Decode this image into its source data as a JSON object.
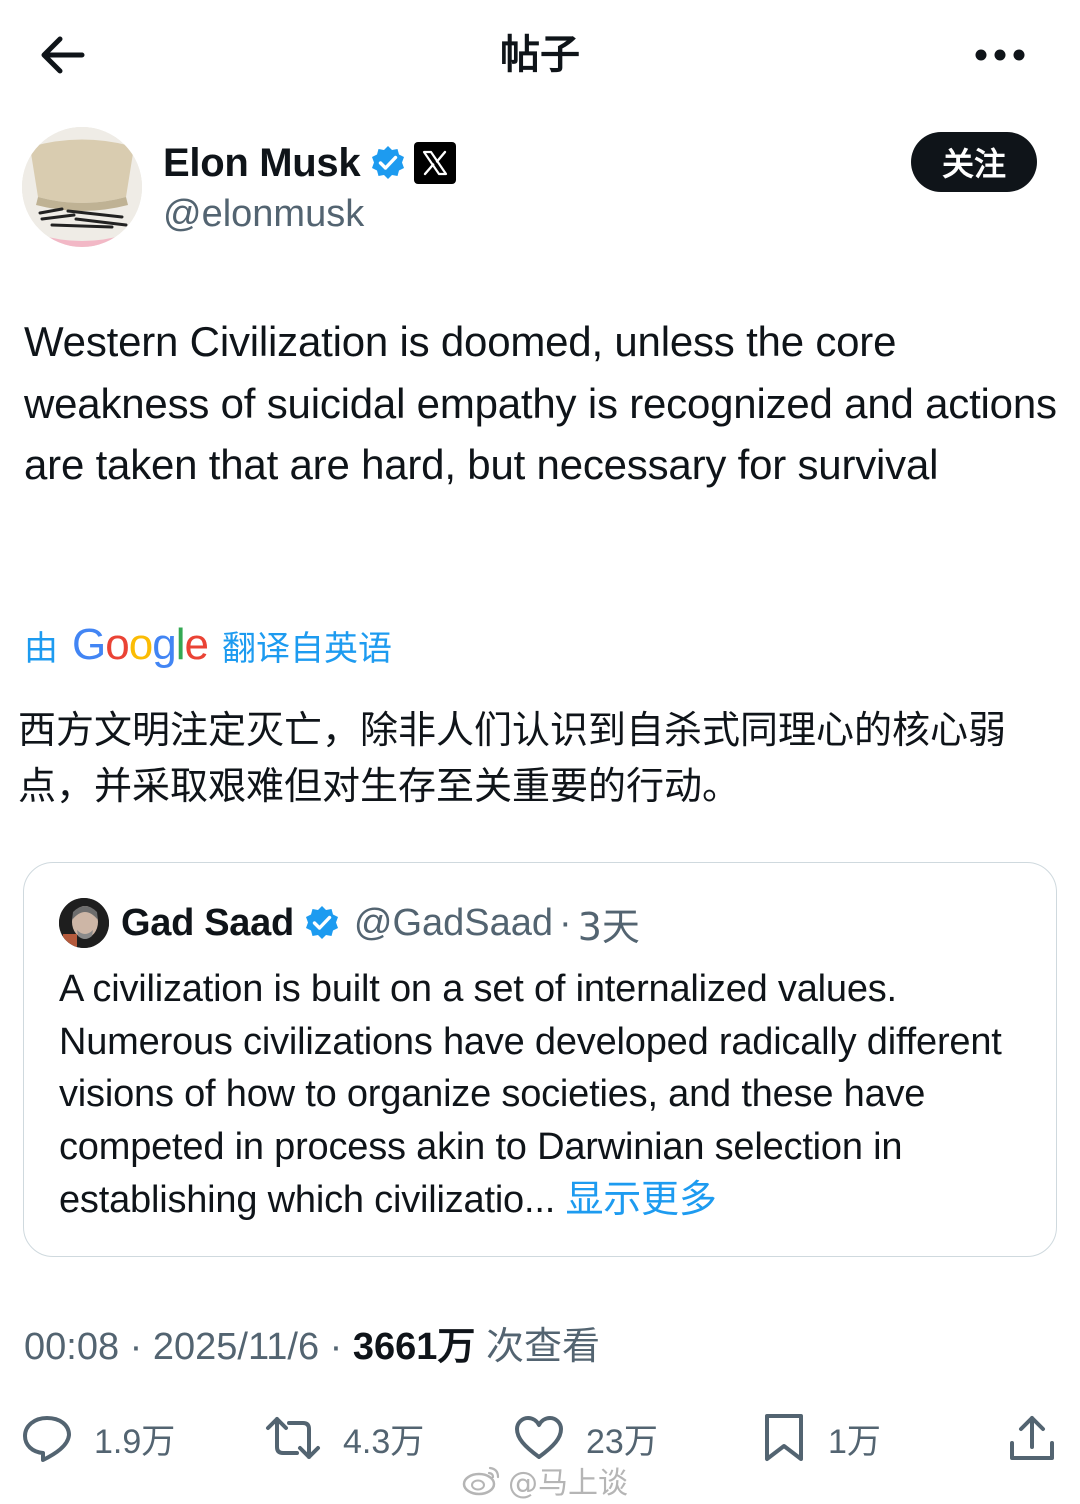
{
  "header": {
    "title": "帖子",
    "back_icon": "arrow-left-icon",
    "more_icon": "more-horizontal-icon"
  },
  "author": {
    "name": "Elon Musk",
    "handle": "@elonmusk",
    "follow_label": "关注",
    "verified_color": "#1d9bf0"
  },
  "tweet": {
    "text": "Western Civilization is doomed, unless the core weakness of suicidal empathy is recognized and actions are taken that are hard, but necessary for survival"
  },
  "translation": {
    "by_label": "由",
    "google_label": "Google",
    "from_label": "翻译自英语",
    "text": "西方文明注定灭亡，除非人们认识到自杀式同理心的核心弱点，并采取艰难但对生存至关重要的行动。"
  },
  "quote": {
    "name": "Gad Saad",
    "handle": "@GadSaad",
    "separator": "·",
    "time": "3天",
    "text": "A civilization is built on a set of internalized values. Numerous civilizations have developed radically different visions of how to organize societies, and these have competed in process akin to Darwinian selection in establishing which civilizatio...",
    "show_more": "显示更多"
  },
  "meta": {
    "time": "00:08",
    "sep1": "·",
    "date": "2025/11/6",
    "sep2": "·",
    "views_count": "3661万",
    "views_label": "次查看"
  },
  "actions": {
    "reply_count": "1.9万",
    "retweet_count": "4.3万",
    "like_count": "23万",
    "bookmark_count": "1万"
  },
  "watermark": {
    "text": "@马上谈"
  },
  "colors": {
    "accent": "#1d9bf0",
    "text": "#0f1419",
    "muted": "#536471",
    "border": "#cfd9de"
  }
}
